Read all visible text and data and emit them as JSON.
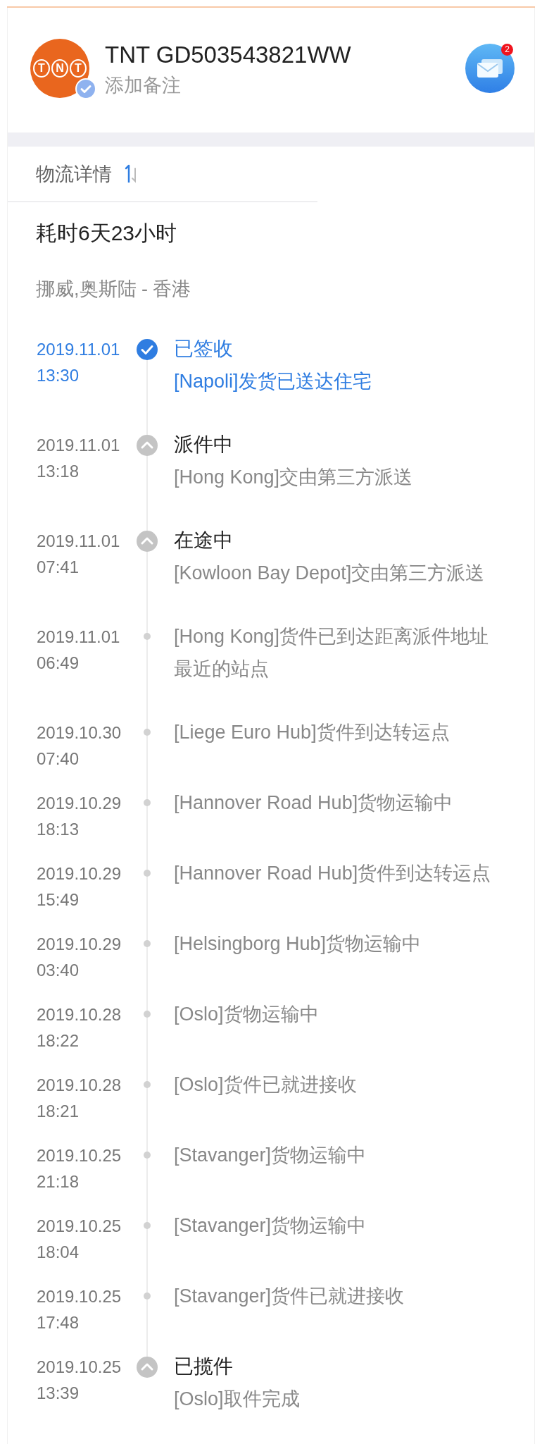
{
  "header": {
    "logo_text": [
      "T",
      "N",
      "T"
    ],
    "verified": true,
    "title": "TNT GD503543821WW",
    "note": "添加备注",
    "message_badge": "2"
  },
  "tab": {
    "label": "物流详情"
  },
  "summary": {
    "duration": "耗时6天23小时",
    "route": "挪威,奥斯陆 - 香港"
  },
  "events": [
    {
      "kind": "current",
      "date": "2019.11.01",
      "time": "13:30",
      "status": "已签收",
      "detail": "[Napoli]发货已送达住宅"
    },
    {
      "kind": "milestone",
      "date": "2019.11.01",
      "time": "13:18",
      "status": "派件中",
      "detail": "[Hong Kong]交由第三方派送"
    },
    {
      "kind": "milestone",
      "date": "2019.11.01",
      "time": "07:41",
      "status": "在途中",
      "detail": "[Kowloon Bay Depot]交由第三方派送"
    },
    {
      "kind": "event",
      "date": "2019.11.01",
      "time": "06:49",
      "detail": "[Hong Kong]货件已到达距离派件地址最近的站点"
    },
    {
      "kind": "event",
      "date": "2019.10.30",
      "time": "07:40",
      "detail": "[Liege Euro Hub]货件到达转运点"
    },
    {
      "kind": "event",
      "date": "2019.10.29",
      "time": "18:13",
      "detail": "[Hannover Road Hub]货物运输中"
    },
    {
      "kind": "event",
      "date": "2019.10.29",
      "time": "15:49",
      "detail": "[Hannover Road Hub]货件到达转运点"
    },
    {
      "kind": "event",
      "date": "2019.10.29",
      "time": "03:40",
      "detail": "[Helsingborg Hub]货物运输中"
    },
    {
      "kind": "event",
      "date": "2019.10.28",
      "time": "18:22",
      "detail": "[Oslo]货物运输中"
    },
    {
      "kind": "event",
      "date": "2019.10.28",
      "time": "18:21",
      "detail": "[Oslo]货件已就进接收"
    },
    {
      "kind": "event",
      "date": "2019.10.25",
      "time": "21:18",
      "detail": "[Stavanger]货物运输中"
    },
    {
      "kind": "event",
      "date": "2019.10.25",
      "time": "18:04",
      "detail": "[Stavanger]货物运输中"
    },
    {
      "kind": "event",
      "date": "2019.10.25",
      "time": "17:48",
      "detail": "[Stavanger]货件已就进接收"
    },
    {
      "kind": "milestone",
      "date": "2019.10.25",
      "time": "13:39",
      "status": "已揽件",
      "detail": "[Oslo]取件完成"
    }
  ]
}
